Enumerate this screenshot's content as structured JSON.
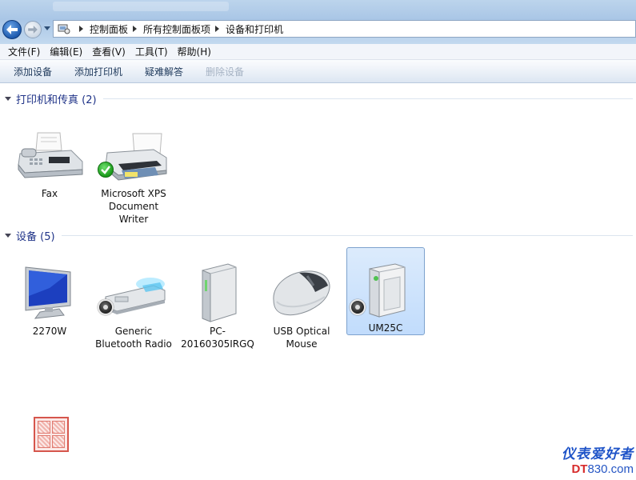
{
  "breadcrumb": [
    "控制面板",
    "所有控制面板项",
    "设备和打印机"
  ],
  "menu": [
    "文件(F)",
    "编辑(E)",
    "查看(V)",
    "工具(T)",
    "帮助(H)"
  ],
  "commands": [
    {
      "label": "添加设备",
      "enabled": true
    },
    {
      "label": "添加打印机",
      "enabled": true
    },
    {
      "label": "疑难解答",
      "enabled": true
    },
    {
      "label": "删除设备",
      "enabled": false
    }
  ],
  "groups": {
    "printers": {
      "title": "打印机和传真 (2)"
    },
    "devices": {
      "title": "设备 (5)"
    }
  },
  "printers": [
    {
      "label": "Fax",
      "icon": "fax-icon"
    },
    {
      "label": "Microsoft XPS Document Writer",
      "icon": "printer-icon",
      "badge": "default-check"
    }
  ],
  "devices": [
    {
      "label": "2270W",
      "icon": "monitor-icon"
    },
    {
      "label": "Generic Bluetooth Radio",
      "icon": "bluetooth-adapter-icon",
      "badge": "status-disc"
    },
    {
      "label": "PC-20160305IRGQ",
      "icon": "computer-tower-icon"
    },
    {
      "label": "USB Optical Mouse",
      "icon": "mouse-icon"
    },
    {
      "label": "UM25C",
      "icon": "usb-device-icon",
      "badge": "status-disc",
      "selected": true
    }
  ],
  "watermark": {
    "cn": "仪表爱好者",
    "url_prefix": "DT",
    "url_suffix": "830.com"
  },
  "seal_text": "鄙人印"
}
